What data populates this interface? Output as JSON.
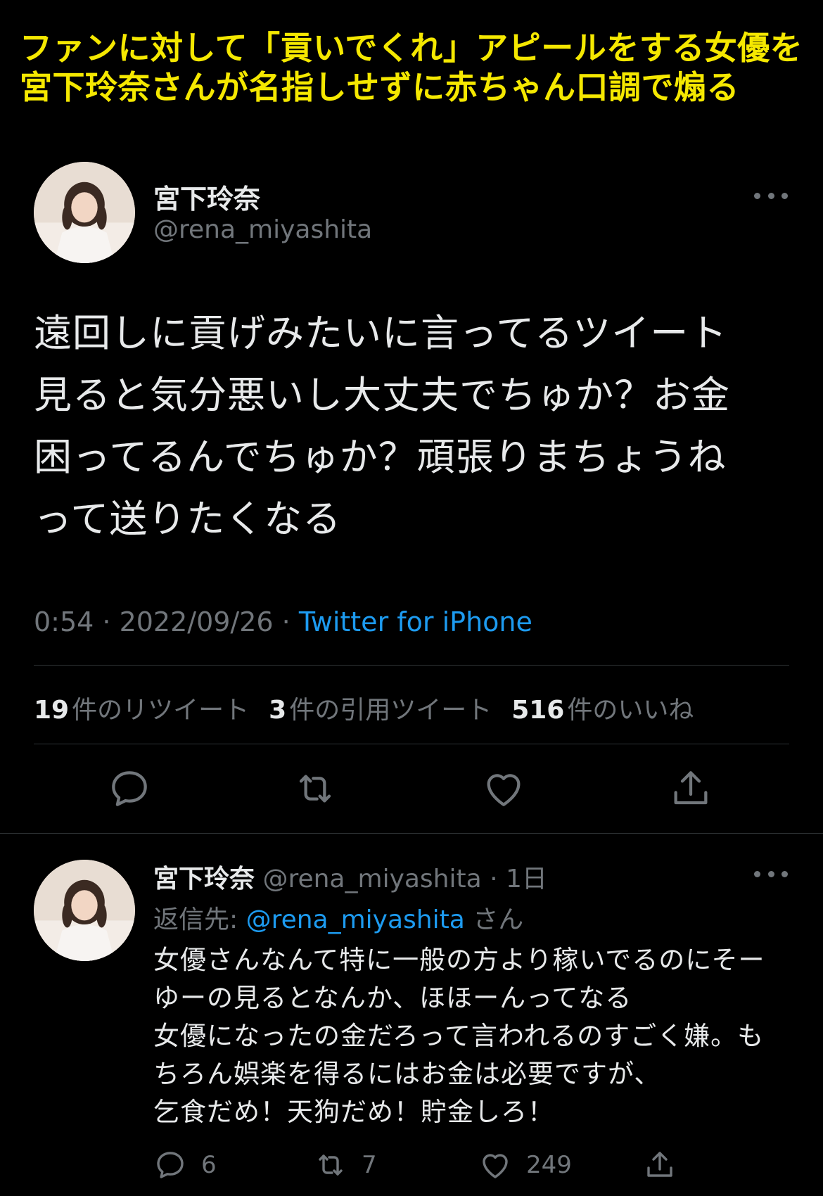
{
  "caption": {
    "line1": "ファンに対して「貢いでくれ」アピールをする女優を",
    "line2": "宮下玲奈さんが名指しせずに赤ちゃん口調で煽る"
  },
  "tweet": {
    "display_name": "宮下玲奈",
    "handle": "@rena_miyashita",
    "text_lines": [
      "遠回しに貢げみたいに言ってるツイート",
      "見ると気分悪いし大丈夫でちゅか？お金",
      "困ってるんでちゅか？頑張りまちょうね",
      "って送りたくなる"
    ],
    "time": "0:54 · 2022/09/26 · ",
    "source": "Twitter for iPhone",
    "stats": {
      "retweets_count": "19",
      "retweets_label": "件のリツイート",
      "quotes_count": "3",
      "quotes_label": "件の引用ツイート",
      "likes_count": "516",
      "likes_label": "件のいいね"
    },
    "icons": [
      "reply-icon",
      "retweet-icon",
      "like-icon",
      "share-icon",
      "more-icon"
    ]
  },
  "reply": {
    "display_name": "宮下玲奈",
    "handle_time": " @rena_miyashita · 1日",
    "reply_to_label": "返信先: ",
    "reply_to_mention": "@rena_miyashita",
    "reply_to_suffix": " さん",
    "text_lines": [
      "女優さんなんて特に一般の方より稼いでるのにそー",
      "ゆーの見るとなんか、ほほーんってなる",
      "女優になったの金だろって言われるのすごく嫌。も",
      "ちろん娯楽を得るにはお金は必要ですが、",
      "乞食だめ！天狗だめ！貯金しろ！"
    ],
    "reply_count": "6",
    "retweet_count": "7",
    "like_count": "249"
  },
  "colors": {
    "background": "#000000",
    "caption": "#f5e800",
    "text": "#e7e9ea",
    "muted": "#71767b",
    "link": "#1d9bf0"
  }
}
